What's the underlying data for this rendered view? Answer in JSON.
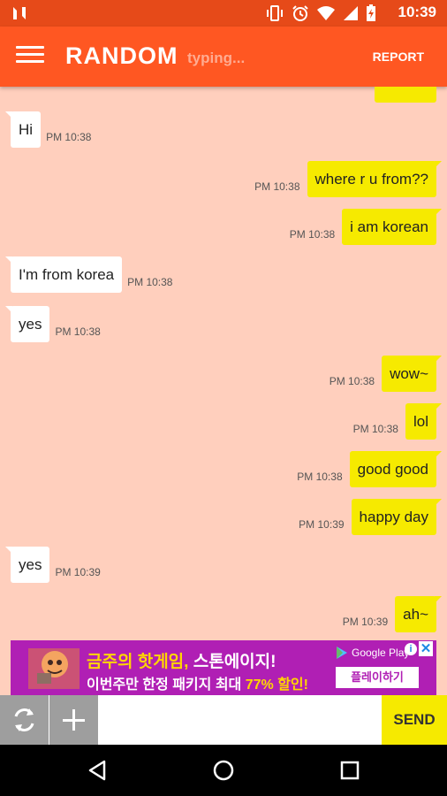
{
  "status_bar": {
    "time": "10:39",
    "icons": [
      "n-logo-icon",
      "vibrate-icon",
      "alarm-icon",
      "wifi-icon",
      "signal-icon",
      "battery-charging-icon"
    ]
  },
  "app_bar": {
    "title": "RANDOM",
    "status": "typing...",
    "report_label": "REPORT"
  },
  "messages": [
    {
      "from": "them",
      "text": "Hi",
      "time": "PM 10:38"
    },
    {
      "from": "me",
      "text": "where r u from??",
      "time": "PM 10:38"
    },
    {
      "from": "me",
      "text": "i am korean",
      "time": "PM 10:38"
    },
    {
      "from": "them",
      "text": "I'm from korea",
      "time": "PM 10:38"
    },
    {
      "from": "them",
      "text": "yes",
      "time": "PM 10:38"
    },
    {
      "from": "me",
      "text": "wow~",
      "time": "PM 10:38"
    },
    {
      "from": "me",
      "text": "lol",
      "time": "PM 10:38"
    },
    {
      "from": "me",
      "text": "good good",
      "time": "PM 10:38"
    },
    {
      "from": "me",
      "text": "happy day",
      "time": "PM 10:39"
    },
    {
      "from": "them",
      "text": "yes",
      "time": "PM 10:39"
    },
    {
      "from": "me",
      "text": "ah~",
      "time": "PM 10:39"
    }
  ],
  "ad": {
    "headline_a": "금주의 핫게임,",
    "headline_b": "스톤에이지!",
    "sub_a": "이번주만 한정 패키지 최대",
    "sub_b": "77% 할인!",
    "store_label": "Google Play",
    "cta_label": "플레이하기"
  },
  "composer": {
    "input_value": "",
    "input_placeholder": "",
    "send_label": "SEND"
  },
  "colors": {
    "app_bar": "#ff5722",
    "status_bar": "#e64a19",
    "chat_bg": "#ffcfbd",
    "my_bubble": "#f6ea00",
    "their_bubble": "#ffffff",
    "ad_bg": "#b01fb4"
  }
}
